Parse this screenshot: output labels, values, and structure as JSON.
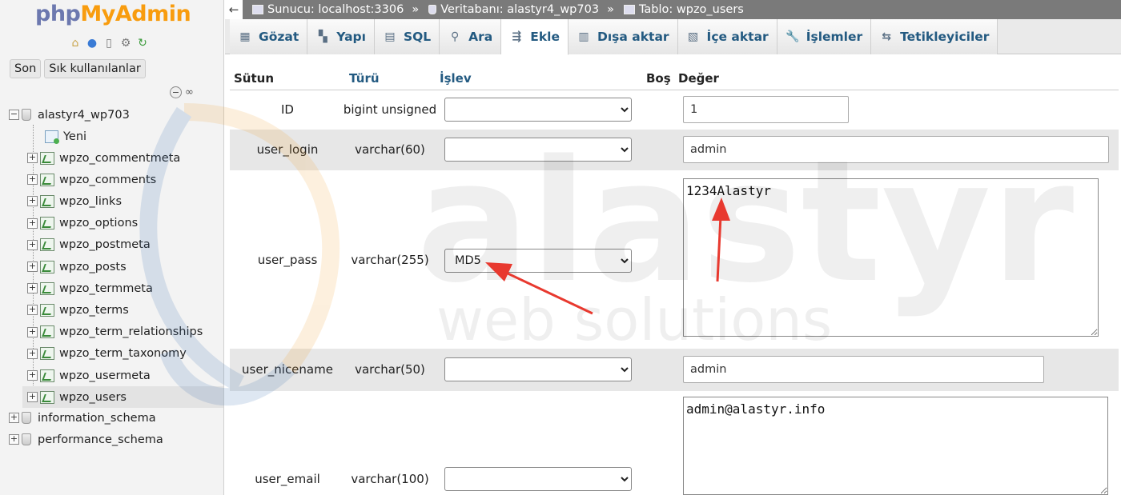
{
  "app": {
    "logo_php": "php",
    "logo_my": "MyAdmin"
  },
  "sidebar": {
    "tabs": [
      "Son",
      "Sık kullanılanlar"
    ],
    "icons": [
      "home-icon",
      "info-icon",
      "docs-icon",
      "settings-icon",
      "reload-icon"
    ],
    "tree": {
      "db_main": "alastyr4_wp703",
      "new_label": "Yeni",
      "tables": [
        "wpzo_commentmeta",
        "wpzo_comments",
        "wpzo_links",
        "wpzo_options",
        "wpzo_postmeta",
        "wpzo_posts",
        "wpzo_termmeta",
        "wpzo_terms",
        "wpzo_term_relationships",
        "wpzo_term_taxonomy",
        "wpzo_usermeta",
        "wpzo_users"
      ],
      "other_dbs": [
        "information_schema",
        "performance_schema"
      ]
    }
  },
  "breadcrumb": {
    "server": "Sunucu: localhost:3306",
    "database": "Veritabanı: alastyr4_wp703",
    "table": "Tablo: wpzo_users",
    "sep": "»"
  },
  "tabs": [
    {
      "label": "Gözat",
      "icon": "browse-icon"
    },
    {
      "label": "Yapı",
      "icon": "structure-icon"
    },
    {
      "label": "SQL",
      "icon": "sql-icon"
    },
    {
      "label": "Ara",
      "icon": "search-icon"
    },
    {
      "label": "Ekle",
      "icon": "insert-icon"
    },
    {
      "label": "Dışa aktar",
      "icon": "export-icon"
    },
    {
      "label": "İçe aktar",
      "icon": "import-icon"
    },
    {
      "label": "İşlemler",
      "icon": "wrench-icon"
    },
    {
      "label": "Tetikleyiciler",
      "icon": "triggers-icon"
    }
  ],
  "active_tab": "Ekle",
  "form": {
    "headers": {
      "column": "Sütun",
      "type": "Türü",
      "function": "İşlev",
      "null": "Boş",
      "value": "Değer"
    },
    "rows": [
      {
        "name": "ID",
        "type": "bigint unsigned",
        "function": "",
        "value": "1"
      },
      {
        "name": "user_login",
        "type": "varchar(60)",
        "function": "",
        "value": "admin"
      },
      {
        "name": "user_pass",
        "type": "varchar(255)",
        "function": "MD5",
        "value": "1234Alastyr"
      },
      {
        "name": "user_nicename",
        "type": "varchar(50)",
        "function": "",
        "value": "admin"
      },
      {
        "name": "user_email",
        "type": "varchar(100)",
        "function": "",
        "value": "admin@alastyr.info"
      }
    ]
  },
  "watermark": {
    "line1": "alastyr",
    "line2": "web solutions"
  },
  "colors": {
    "topbar": "#7a7a7a",
    "link": "#235a81",
    "arrow": "#e8392f",
    "logo_php": "#6c78af",
    "logo_my": "#f89c0e"
  }
}
